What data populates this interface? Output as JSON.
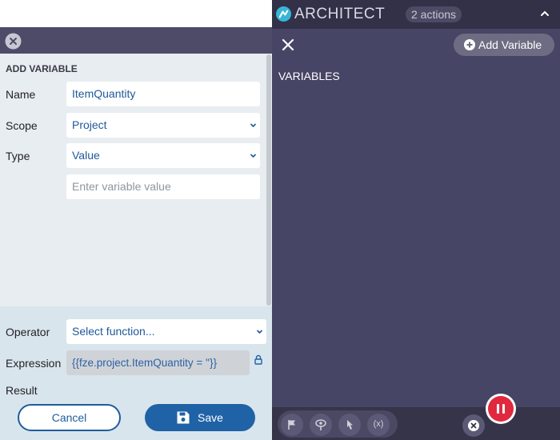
{
  "architect": {
    "title": "ARCHITECT",
    "actions_badge": "2 actions",
    "add_variable_label": "Add Variable",
    "variables_heading": "VARIABLES",
    "toolbar": {
      "variable_tool_text": "(x)"
    },
    "icons": [
      "architect-logo-icon",
      "chevron-up-icon",
      "close-icon",
      "plus-circle-icon",
      "flag-icon",
      "eye-pin-icon",
      "pointer-click-icon",
      "variable-icon",
      "close-circle-icon",
      "pause-icon"
    ],
    "colors": {
      "panel_bg": "#474565",
      "header_bg": "#333148",
      "record": "#e0293e",
      "logo": "#38b6d8"
    }
  },
  "add_variable": {
    "heading": "ADD VARIABLE",
    "name_label": "Name",
    "name_value": "ItemQuantity",
    "scope_label": "Scope",
    "scope_value": "Project",
    "type_label": "Type",
    "type_value": "Value",
    "value_placeholder": "Enter variable value",
    "operator_label": "Operator",
    "operator_value": "Select function...",
    "expression_label": "Expression",
    "expression_value": "{{fze.project.ItemQuantity = ''}}",
    "result_label": "Result",
    "cancel_label": "Cancel",
    "save_label": "Save",
    "colors": {
      "accent": "#1f62a6",
      "field_text": "#20589a",
      "panel_bg": "#e8edf1",
      "bottom_bg": "#d9e5ec"
    }
  }
}
